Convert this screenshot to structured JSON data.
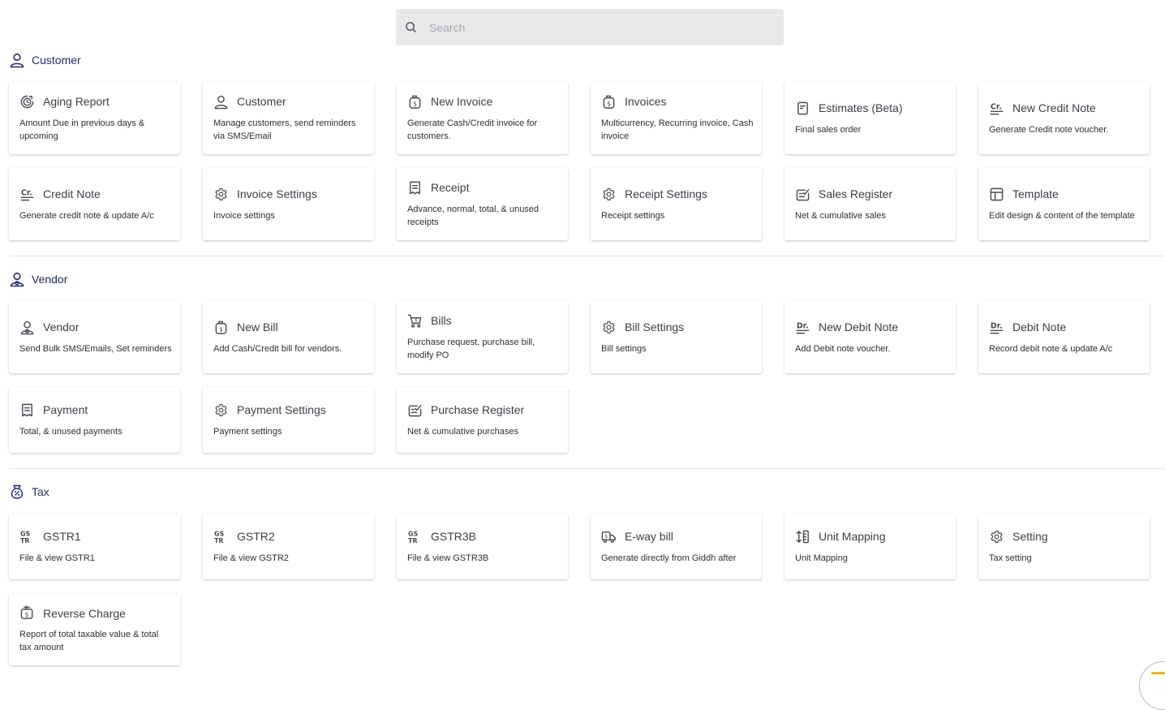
{
  "search": {
    "placeholder": "Search",
    "value": ""
  },
  "sections": {
    "customer": {
      "label": "Customer",
      "cards": [
        {
          "title": "Aging Report",
          "desc": "Amount Due in previous days & upcoming",
          "icon": "aging-report-icon"
        },
        {
          "title": "Customer",
          "desc": "Manage customers, send reminders via SMS/Email",
          "icon": "customer-icon"
        },
        {
          "title": "New Invoice",
          "desc": "Generate Cash/Credit invoice for customers.",
          "icon": "invoice-icon"
        },
        {
          "title": "Invoices",
          "desc": "Multicurrency, Recurring invoice, Cash invoice",
          "icon": "invoice-icon"
        },
        {
          "title": "Estimates (Beta)",
          "desc": "Final sales order",
          "icon": "estimate-icon"
        },
        {
          "title": "New Credit Note",
          "desc": "Generate Credit note voucher.",
          "icon": "credit-note-icon"
        },
        {
          "title": "Credit Note",
          "desc": "Generate credit note & update A/c",
          "icon": "credit-note-icon"
        },
        {
          "title": "Invoice Settings",
          "desc": "Invoice settings",
          "icon": "gear-icon"
        },
        {
          "title": "Receipt",
          "desc": "Advance, normal, total, & unused receipts",
          "icon": "receipt-icon"
        },
        {
          "title": "Receipt Settings",
          "desc": "Receipt settings",
          "icon": "gear-icon"
        },
        {
          "title": "Sales Register",
          "desc": "Net & cumulative sales",
          "icon": "register-icon"
        },
        {
          "title": "Template",
          "desc": "Edit design & content of the template",
          "icon": "template-icon"
        }
      ]
    },
    "vendor": {
      "label": "Vendor",
      "cards": [
        {
          "title": "Vendor",
          "desc": "Send Bulk SMS/Emails, Set reminders",
          "icon": "vendor-icon"
        },
        {
          "title": "New Bill",
          "desc": "Add Cash/Credit bill for vendors.",
          "icon": "bill-icon"
        },
        {
          "title": "Bills",
          "desc": "Purchase request, purchase bill, modify PO",
          "icon": "cart-icon"
        },
        {
          "title": "Bill Settings",
          "desc": "Bill settings",
          "icon": "gear-icon"
        },
        {
          "title": "New Debit Note",
          "desc": "Add Debit note voucher.",
          "icon": "debit-note-icon"
        },
        {
          "title": "Debit Note",
          "desc": "Record debit note & update A/c",
          "icon": "debit-note-icon"
        },
        {
          "title": "Payment",
          "desc": "Total, & unused payments",
          "icon": "receipt-icon"
        },
        {
          "title": "Payment Settings",
          "desc": "Payment settings",
          "icon": "gear-icon"
        },
        {
          "title": "Purchase Register",
          "desc": "Net & cumulative purchases",
          "icon": "register-icon"
        }
      ]
    },
    "tax": {
      "label": "Tax",
      "cards": [
        {
          "title": "GSTR1",
          "desc": "File & view GSTR1",
          "icon": "gstr-icon"
        },
        {
          "title": "GSTR2",
          "desc": "File & view GSTR2",
          "icon": "gstr-icon"
        },
        {
          "title": "GSTR3B",
          "desc": "File & view GSTR3B",
          "icon": "gstr-icon"
        },
        {
          "title": "E-way bill",
          "desc": "Generate directly from Giddh after",
          "icon": "truck-icon"
        },
        {
          "title": "Unit Mapping",
          "desc": "Unit Mapping",
          "icon": "unit-mapping-icon"
        },
        {
          "title": "Setting",
          "desc": "Tax setting",
          "icon": "gear-icon"
        },
        {
          "title": "Reverse Charge",
          "desc": "Report of total taxable value & total tax amount",
          "icon": "reverse-charge-icon"
        }
      ]
    }
  }
}
